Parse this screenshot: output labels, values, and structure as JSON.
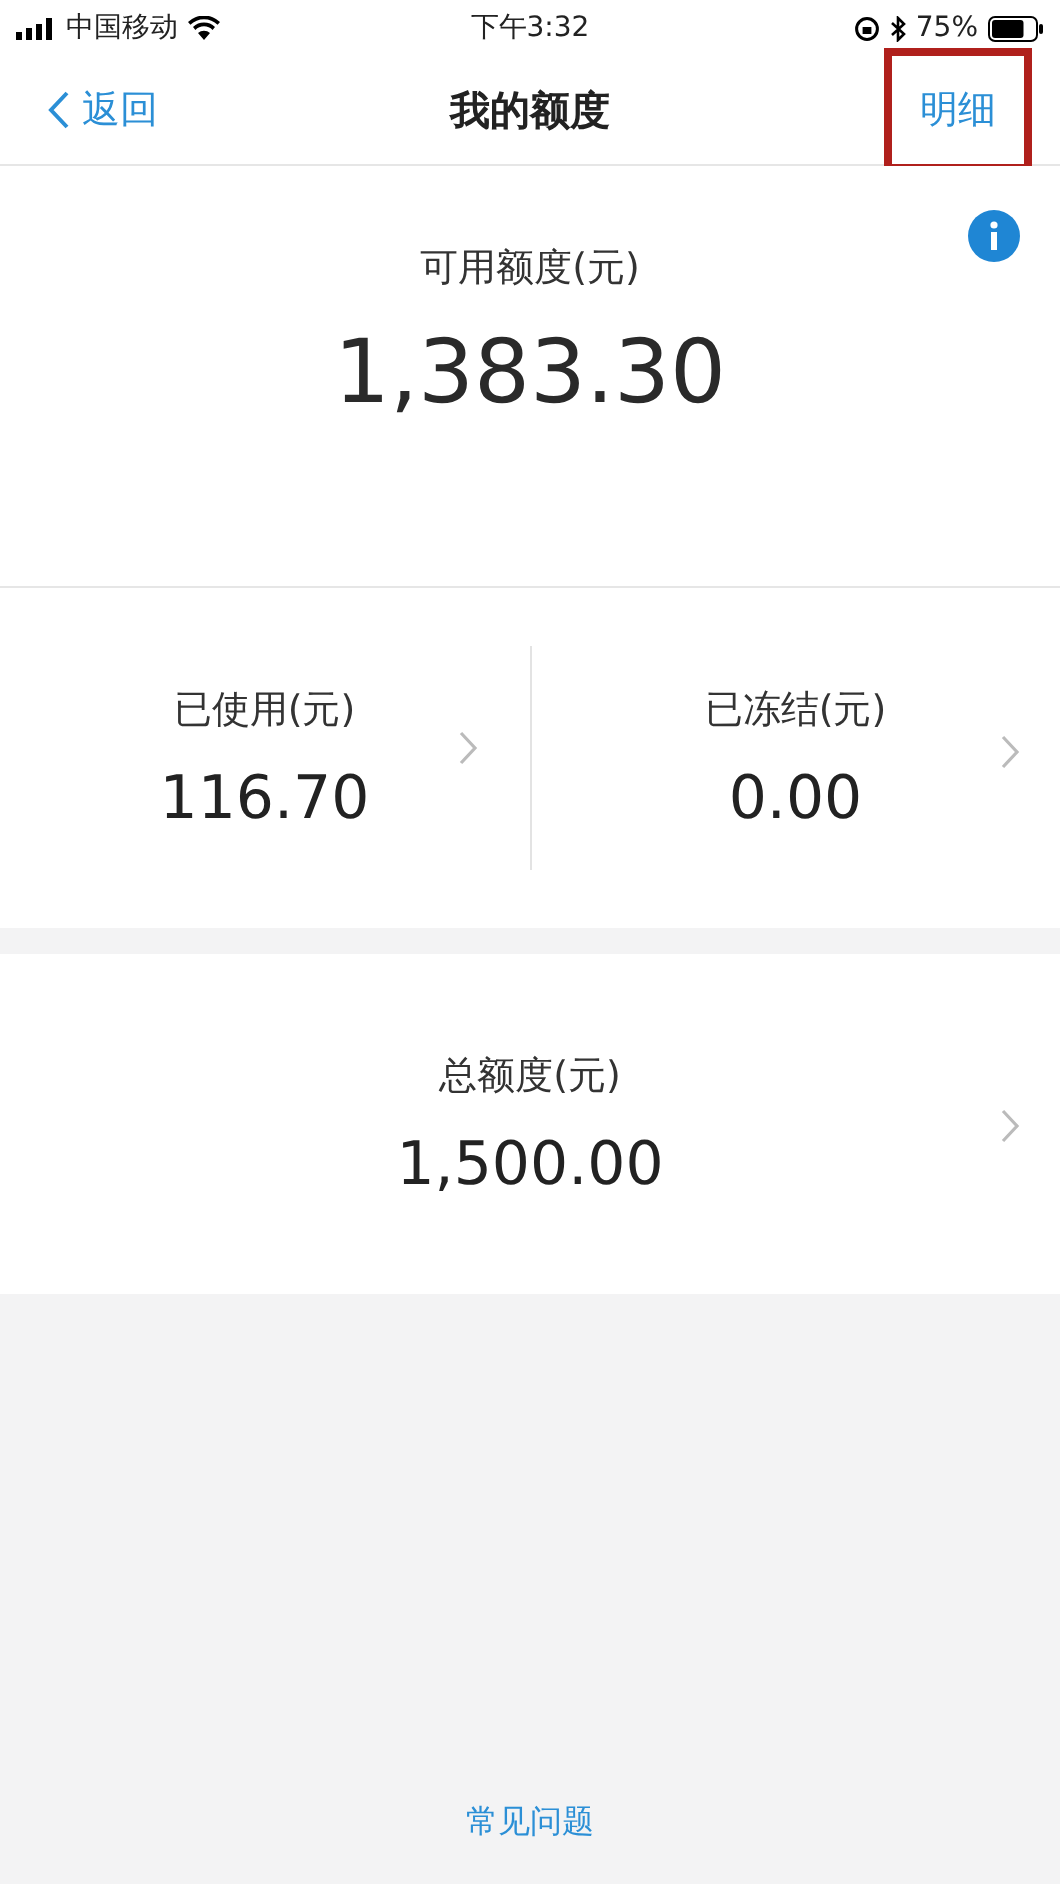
{
  "status_bar": {
    "carrier": "中国移动",
    "time": "下午3:32",
    "battery": "75%"
  },
  "nav": {
    "back": "返回",
    "title": "我的额度",
    "detail": {
      "label": "明细",
      "highlighted": true
    }
  },
  "available": {
    "label": "可用额度(元)",
    "amount": "1,383.30"
  },
  "stats": [
    {
      "label": "已使用(元)",
      "amount": "116.70"
    },
    {
      "label": "已冻结(元)",
      "amount": "0.00"
    }
  ],
  "total": {
    "label": "总额度(元)",
    "amount": "1,500.00"
  },
  "faq_link": "常见问题"
}
